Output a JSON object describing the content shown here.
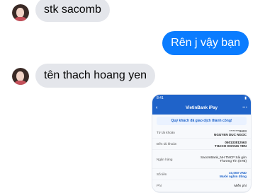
{
  "messages": [
    {
      "sender": "incoming",
      "text": "stk sacomb"
    },
    {
      "sender": "outgoing",
      "text": "Rên j vậy bạn"
    },
    {
      "sender": "incoming",
      "text": "tên thach hoang yen"
    }
  ],
  "screenshot_msg": {
    "status_time": "8:41",
    "title": "VietinBank iPay",
    "banner": "Quý khách đã giao dịch thành công!",
    "rows": [
      {
        "label": "Từ tài khoản",
        "value1": "********9603",
        "value2": "NGUYEN DUC NGOC"
      },
      {
        "label": "Đến tài khoản",
        "value1": "050133812563",
        "value2": "THACH HOANG YEN"
      },
      {
        "label": "Ngân hàng",
        "value1": "SacomBank_NH TMCP Sài gòn",
        "value2": "Thương Tín (STB)"
      },
      {
        "label": "Số tiền",
        "value1": "10,000 VND",
        "value2": "Mười nghìn đồng"
      },
      {
        "label": "Phí",
        "value1": "Miễn phí",
        "value2": ""
      }
    ]
  },
  "colors": {
    "outgoing_bubble": "#0a7cff",
    "incoming_bubble": "#e4e6eb",
    "bank_header": "#1f63c9"
  }
}
